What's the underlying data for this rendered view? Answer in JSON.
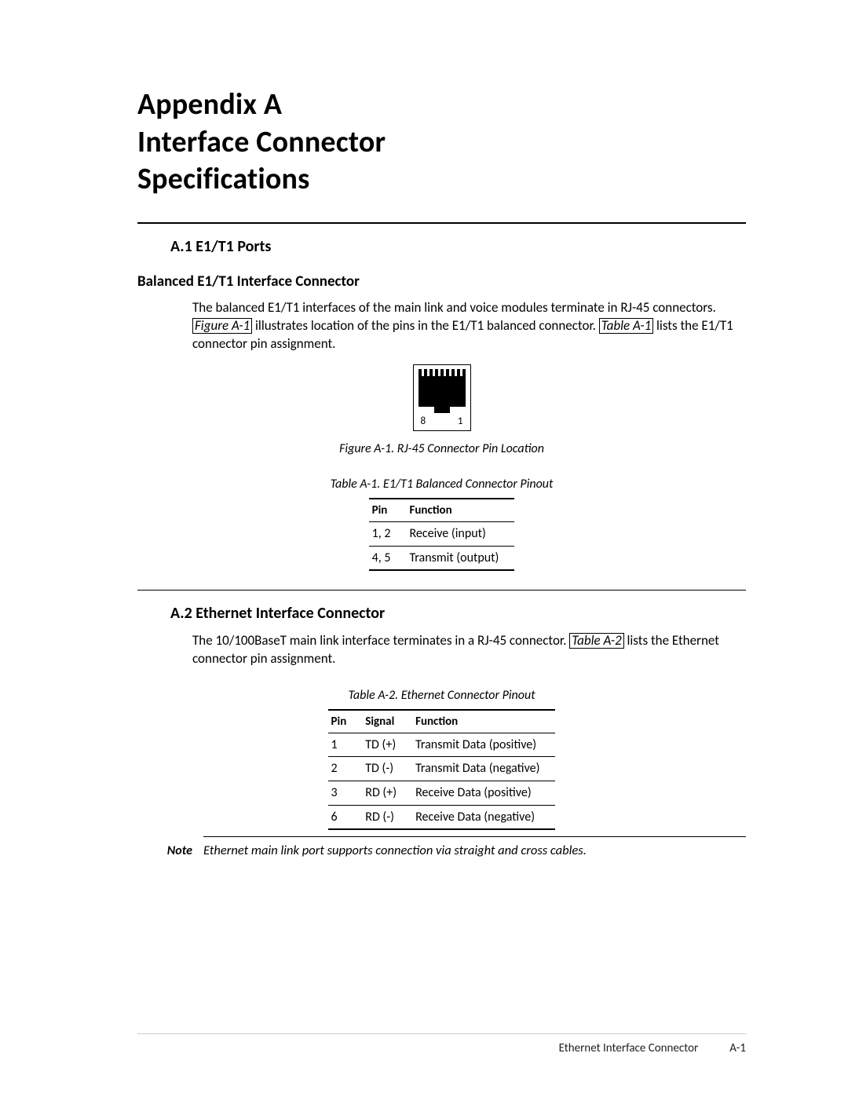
{
  "title": {
    "appendix": "Appendix A",
    "line1": "Interface Connector",
    "line2": "Specifications"
  },
  "sectionA1": {
    "heading": "A.1  E1/T1 Ports",
    "sub": "Balanced E1/T1 Interface Connector",
    "para_pre": "The balanced E1/T1 interfaces of the main link and voice modules terminate in RJ-45 connectors. ",
    "ref1": "Figure A-1",
    "para_mid": " illustrates location of the pins in the E1/T1 balanced connector. ",
    "ref2": "Table A-1",
    "para_post": " lists the E1/T1 connector pin assignment.",
    "figureCaption": "Figure A-1.  RJ-45 Connector Pin Location",
    "pinLabelLeft": "8",
    "pinLabelRight": "1",
    "tableCaption": "Table A-1.  E1/T1 Balanced Connector Pinout",
    "table": {
      "headers": [
        "Pin",
        "Function"
      ],
      "rows": [
        [
          "1, 2",
          "Receive (input)"
        ],
        [
          "4, 5",
          "Transmit (output)"
        ]
      ]
    }
  },
  "sectionA2": {
    "heading": "A.2  Ethernet Interface Connector",
    "para_pre": "The 10/100BaseT main link interface terminates in a RJ-45 connector. ",
    "ref1": "Table A-2",
    "para_post": " lists the Ethernet connector pin assignment.",
    "tableCaption": "Table A-2.  Ethernet Connector Pinout",
    "table": {
      "headers": [
        "Pin",
        "Signal",
        "Function"
      ],
      "rows": [
        [
          "1",
          "TD (+)",
          "Transmit Data (positive)"
        ],
        [
          "2",
          "TD (-)",
          "Transmit Data (negative)"
        ],
        [
          "3",
          "RD (+)",
          "Receive Data (positive)"
        ],
        [
          "6",
          "RD (-)",
          "Receive Data (negative)"
        ]
      ]
    },
    "noteLabel": "Note",
    "noteBody": "Ethernet main link port supports connection via straight and cross cables."
  },
  "footer": {
    "section": "Ethernet Interface Connector",
    "page": "A-1"
  }
}
